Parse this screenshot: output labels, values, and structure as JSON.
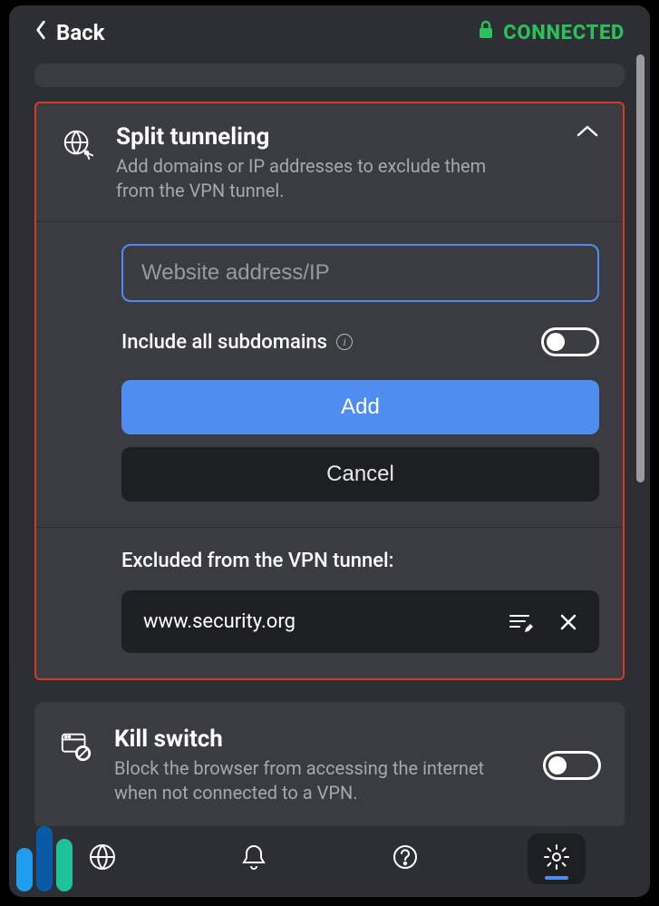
{
  "header": {
    "back_label": "Back",
    "status_label": "CONNECTED"
  },
  "splitTunneling": {
    "title": "Split tunneling",
    "subtitle": "Add domains or IP addresses to exclude them from the VPN tunnel.",
    "input_placeholder": "Website address/IP",
    "input_value": "",
    "include_subdomains_label": "Include all subdomains",
    "include_subdomains_on": false,
    "add_label": "Add",
    "cancel_label": "Cancel",
    "excluded_label": "Excluded from the VPN tunnel:",
    "entries": [
      {
        "domain": "www.security.org"
      }
    ]
  },
  "killSwitch": {
    "title": "Kill switch",
    "subtitle": "Block the browser from accessing the internet when not connected to a VPN.",
    "enabled": false
  },
  "colors": {
    "accent": "#4f8ef0",
    "connected": "#2cc05a",
    "highlight_border": "#d23b2a"
  },
  "icons": {
    "back": "chevron-left-icon",
    "lock": "lock-icon",
    "globe_tunnel": "globe-network-icon",
    "chevron_up": "chevron-up-icon",
    "info": "info-icon",
    "edit_list": "edit-list-icon",
    "close": "close-icon",
    "kill_switch": "browser-block-icon",
    "nav_globe": "globe-icon",
    "nav_bell": "bell-icon",
    "nav_help": "help-icon",
    "nav_settings": "gear-icon"
  }
}
